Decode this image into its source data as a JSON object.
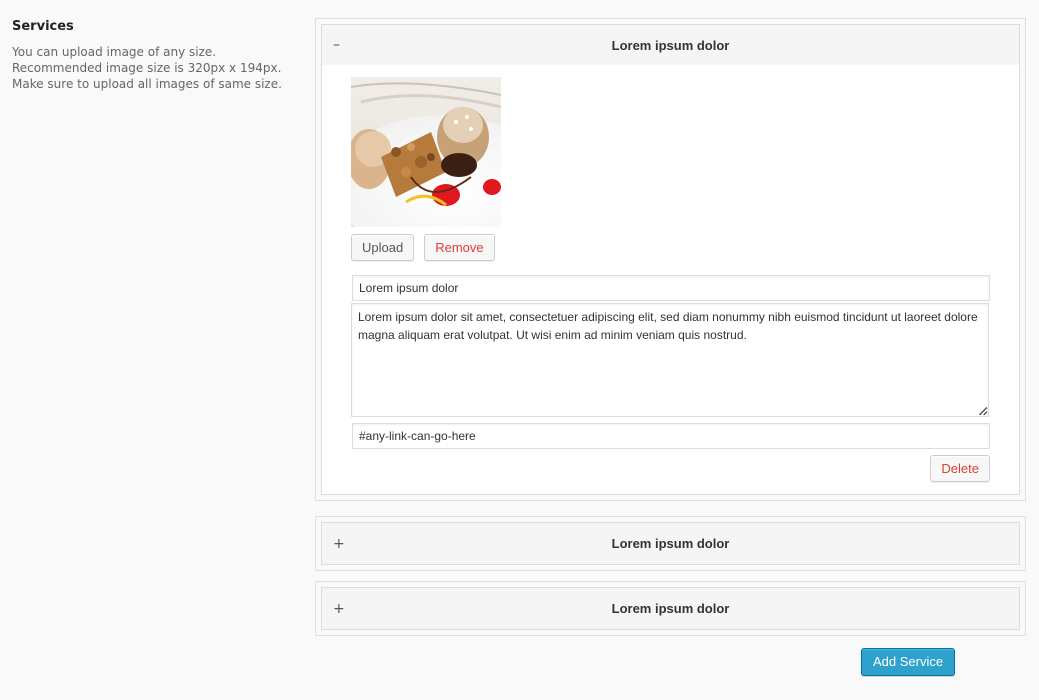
{
  "settings": {
    "title": "Services",
    "description_lines": [
      "You can upload image of any size.",
      "Recommended image size is 320px x 194px.",
      "Make sure to upload all images of same size."
    ]
  },
  "services": [
    {
      "title": "Lorem ipsum dolor",
      "toggle_icon": "minus-icon",
      "toggle_glyph": "–",
      "expanded": true,
      "image_alt": "dessert plate",
      "upload_label": "Upload",
      "remove_label": "Remove",
      "title_value": "Lorem ipsum dolor",
      "description_value": "Lorem ipsum dolor sit amet, consectetuer adipiscing elit, sed diam nonummy nibh euismod tincidunt ut laoreet dolore magna aliquam erat volutpat. Ut wisi enim ad minim veniam quis nostrud.",
      "link_value": "#any-link-can-go-here",
      "delete_label": "Delete"
    },
    {
      "title": "Lorem ipsum dolor",
      "toggle_icon": "plus-icon",
      "toggle_glyph": "+",
      "expanded": false
    },
    {
      "title": "Lorem ipsum dolor",
      "toggle_icon": "plus-icon",
      "toggle_glyph": "+",
      "expanded": false
    }
  ],
  "add_button_label": "Add Service",
  "colors": {
    "accent": "#2ea2cc",
    "danger": "#dd3d36"
  }
}
